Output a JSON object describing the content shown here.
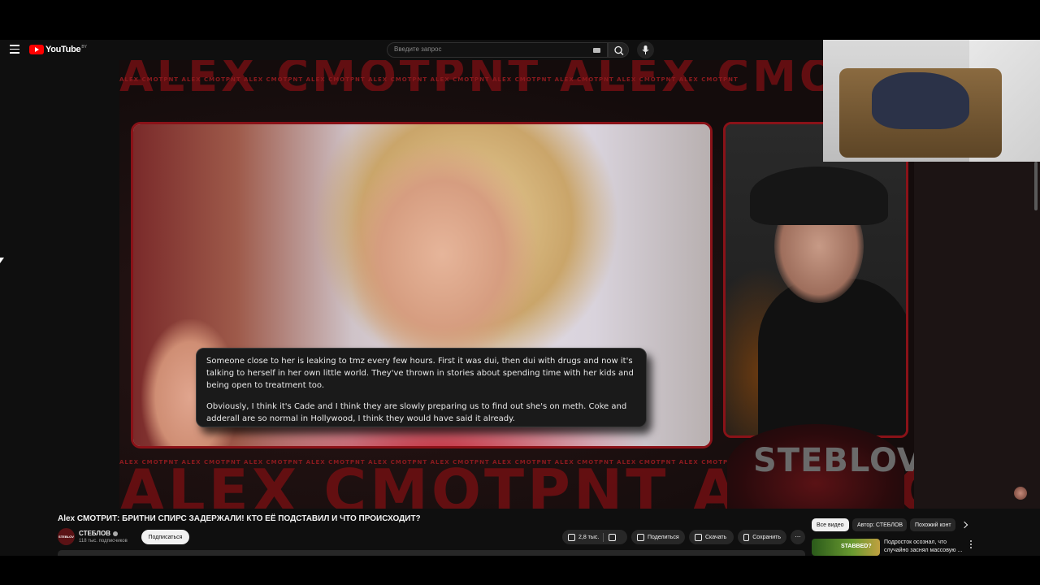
{
  "header": {
    "logo_text": "YouTube",
    "logo_region": "BY",
    "search_placeholder": "Введите запрос"
  },
  "video": {
    "band_text_large": "ALEX CMOTPNT ALEX CMOTPNT",
    "band_text_small": "ALEX CMOTPNT ALEX CMOTPNT ALEX CMOTPNT ALEX CMOTPNT ALEX CMOTPNT ALEX CMOTPNT ALEX CMOTPNT ALEX CMOTPNT ALEX CMOTPNT ALEX CMOTPNT",
    "caption_p1": "Someone close to her is leaking to tmz every few hours. First it was dui, then dui with drugs and now it's talking to herself in her own little world. They've thrown in stories about spending time with her kids and being open to treatment too.",
    "caption_p2": "Obviously, I think it's Cade and I think they are slowly preparing us to find out she's on meth. Coke and adderall are so normal in Hollywood, I think they would have said it already.",
    "watermark": "STEBLOV"
  },
  "meta": {
    "title": "Alex СМОТРИТ: БРИТНИ СПИРС ЗАДЕРЖАЛИ! КТО ЕЁ ПОДСТАВИЛ И ЧТО ПРОИСХОДИТ?",
    "channel_avatar_text": "STEBLOV",
    "channel_name": "СТЕБЛОВ",
    "subscribers": "118 тыс. подписчиков",
    "subscribe_label": "Подписаться",
    "likes": "2,8 тыс.",
    "share_label": "Поделиться",
    "download_label": "Скачать",
    "save_label": "Сохранить"
  },
  "chips": {
    "all": "Все видео",
    "author": "Автор: СТЕБЛОВ",
    "similar": "Похожий конт"
  },
  "recommendation": {
    "thumb_text": "STABBED?",
    "title": "Подросток осознал, что случайно заснял массовую ..."
  }
}
